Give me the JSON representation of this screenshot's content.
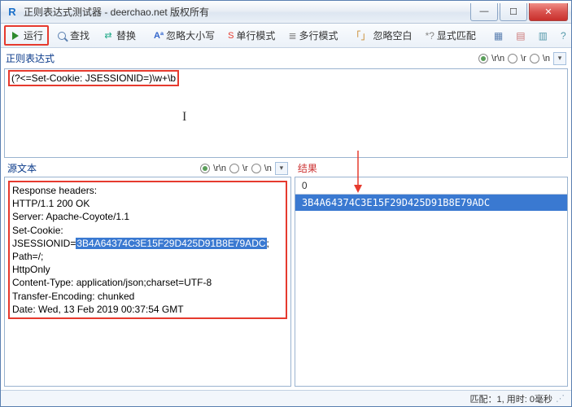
{
  "window": {
    "title": "正则表达式测试器 - deerchao.net 版权所有",
    "icon_letter": "R"
  },
  "toolbar": {
    "run": "运行",
    "find": "查找",
    "replace": "替换",
    "ignorecase": "忽略大小写",
    "singleline": "单行模式",
    "multiline": "多行模式",
    "ignorespace": "忽略空白",
    "explicit": "显式匹配",
    "aa_icon": "Aª",
    "s_icon": "S",
    "sl_icon": "≡",
    "ml_icon": "≣",
    "brk_l": "「",
    "brk_r": "」",
    "star": "*?"
  },
  "regex": {
    "label": "正则表达式",
    "opts": {
      "rn": "\\r\\n",
      "r": "\\r",
      "n": "\\n"
    },
    "value": "(?<=Set-Cookie: JSESSIONID=)\\w+\\b"
  },
  "source": {
    "label": "源文本",
    "text": {
      "l1": "Response headers:",
      "l2": "HTTP/1.1 200 OK",
      "l3": "Server: Apache-Coyote/1.1",
      "l4": "Set-Cookie:",
      "l5a": "JSESSIONID=",
      "l5b": "3B4A64374C3E15F29D425D91B8E79ADC",
      "l5c": "; Path=/;",
      "l6": "HttpOnly",
      "l7": "Content-Type: application/json;charset=UTF-8",
      "l8": "Transfer-Encoding: chunked",
      "l9": "Date: Wed, 13 Feb 2019 00:37:54 GMT"
    }
  },
  "result": {
    "label": "结果",
    "header": "0",
    "row0": "3B4A64374C3E15F29D425D91B8E79ADC"
  },
  "status": {
    "matches": "匹配：1, 用时: 0毫秒"
  }
}
